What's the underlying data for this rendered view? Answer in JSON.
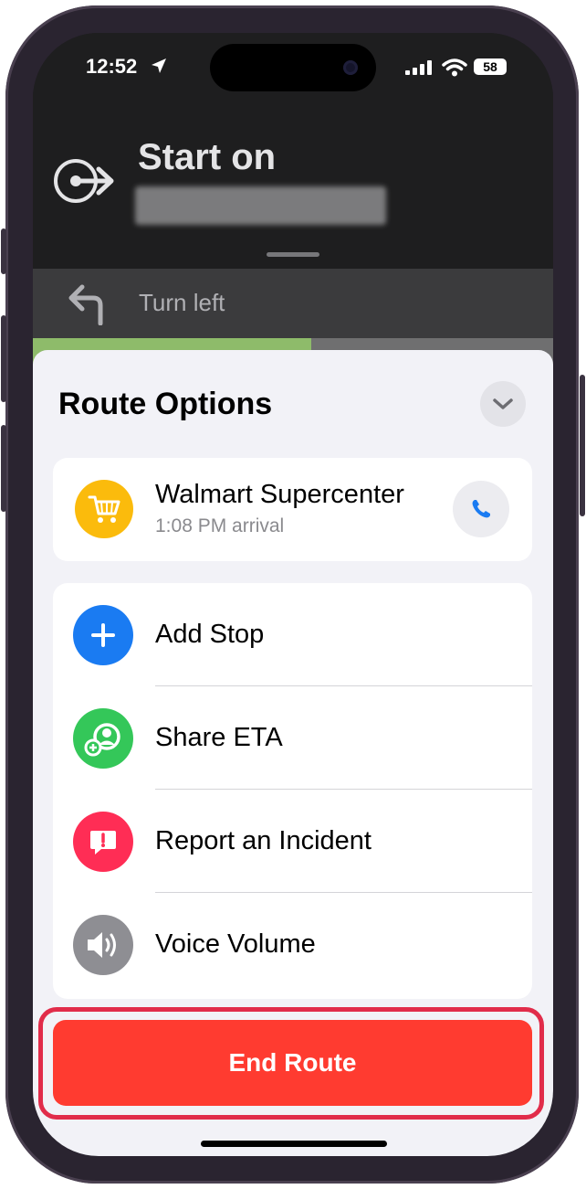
{
  "status_bar": {
    "time": "12:52",
    "battery": "58"
  },
  "navigation": {
    "maneuver_title": "Start on",
    "next_instruction": "Turn left"
  },
  "sheet": {
    "title": "Route Options",
    "destination": {
      "name": "Walmart Supercenter",
      "arrival": "1:08 PM arrival",
      "icon_color": "#fbbb0c"
    },
    "options": [
      {
        "label": "Add Stop",
        "icon": "add-stop-icon",
        "color": "#1a7bf2"
      },
      {
        "label": "Share ETA",
        "icon": "share-eta-icon",
        "color": "#34c759"
      },
      {
        "label": "Report an Incident",
        "icon": "report-incident-icon",
        "color": "#ff2d55"
      },
      {
        "label": "Voice Volume",
        "icon": "voice-volume-icon",
        "color": "#8e8e93"
      }
    ],
    "end_route_label": "End Route"
  },
  "colors": {
    "end_route": "#ff3b30",
    "highlight_outline": "#e12c4a"
  }
}
